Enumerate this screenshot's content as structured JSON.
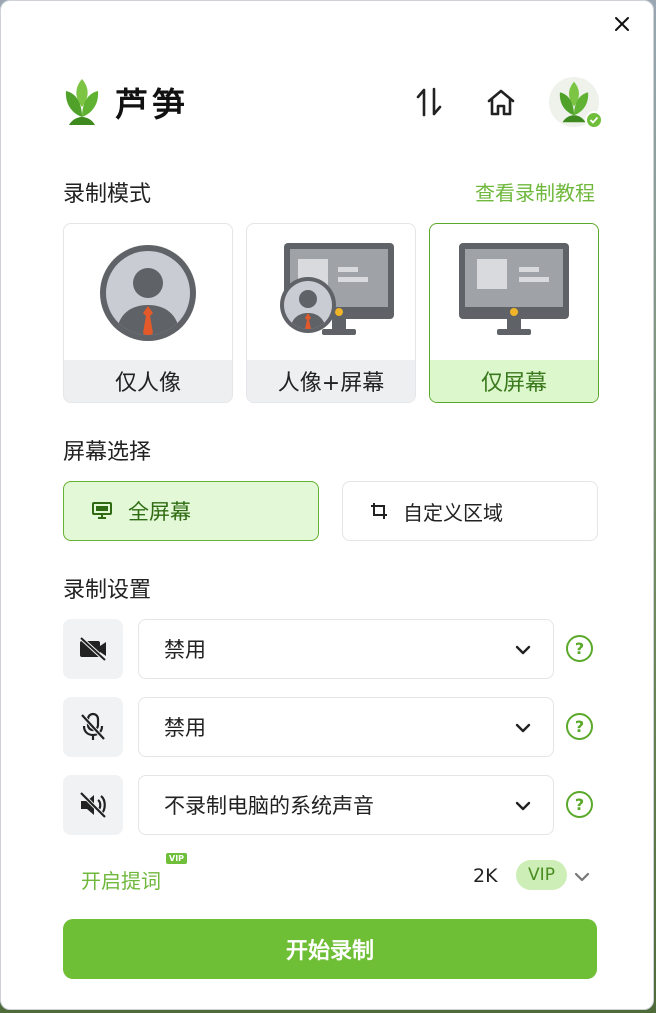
{
  "app": {
    "brand_name": "芦笋"
  },
  "header": {
    "swap_icon": "swap-vertical-icon",
    "home_icon": "home-icon",
    "avatar_icon": "leaf-avatar-icon"
  },
  "record_mode": {
    "title": "录制模式",
    "tutorial_link": "查看录制教程",
    "options": [
      {
        "label": "仅人像",
        "active": false
      },
      {
        "label": "人像+屏幕",
        "active": false
      },
      {
        "label": "仅屏幕",
        "active": true
      }
    ]
  },
  "screen_select": {
    "title": "屏幕选择",
    "options": [
      {
        "label": "全屏幕",
        "active": true,
        "icon": "monitor-icon"
      },
      {
        "label": "自定义区域",
        "active": false,
        "icon": "crop-icon"
      }
    ]
  },
  "record_settings": {
    "title": "录制设置",
    "rows": [
      {
        "icon": "camera-off-icon",
        "value": "禁用"
      },
      {
        "icon": "mic-off-icon",
        "value": "禁用"
      },
      {
        "icon": "speaker-off-icon",
        "value": "不录制电脑的系统声音"
      }
    ]
  },
  "footer": {
    "prompt_label": "开启提词",
    "prompt_badge": "VIP",
    "resolution": "2K",
    "resolution_badge": "VIP"
  },
  "start_button": "开始录制",
  "colors": {
    "accent": "#6fbf36",
    "accent_text": "#6fb83c",
    "active_bg": "#dcf7cc"
  }
}
